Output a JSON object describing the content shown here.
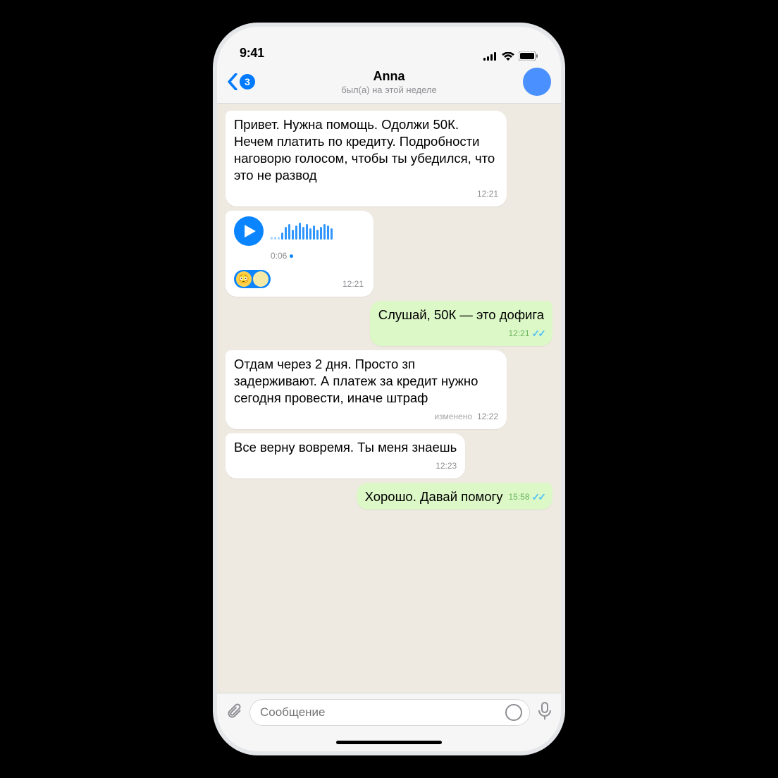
{
  "statusbar": {
    "time": "9:41"
  },
  "header": {
    "unread_count": "3",
    "name": "Anna",
    "status": "был(а) на этой неделе"
  },
  "messages": [
    {
      "side": "in",
      "type": "text",
      "text": "Привет. Нужна помощь. Одолжи 50К. Нечем платить по кредиту. Подробности наговорю голосом, чтобы ты убедился, что это не развод",
      "time": "12:21"
    },
    {
      "side": "in",
      "type": "voice",
      "duration": "0:06",
      "time": "12:21"
    },
    {
      "side": "out",
      "type": "text",
      "text": "Слушай, 50К — это дофига",
      "time": "12:21"
    },
    {
      "side": "in",
      "type": "text",
      "text": "Отдам через 2 дня. Просто зп задерживают. А платеж за кредит нужно сегодня провести, иначе штраф",
      "edited": "изменено",
      "time": "12:22"
    },
    {
      "side": "in",
      "type": "text",
      "text": "Все верну вовремя. Ты меня знаешь",
      "time": "12:23"
    },
    {
      "side": "out",
      "type": "text",
      "text": "Хорошо. Давай помогу",
      "time": "15:58"
    }
  ],
  "composer": {
    "placeholder": "Сообщение"
  }
}
